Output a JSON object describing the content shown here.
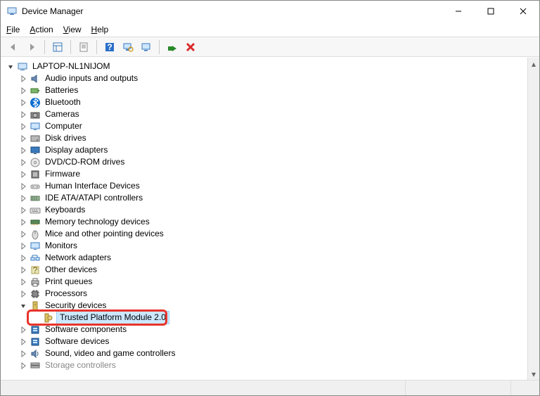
{
  "window": {
    "title": "Device Manager"
  },
  "menus": {
    "file": "File",
    "action": "Action",
    "view": "View",
    "help": "Help"
  },
  "root": {
    "label": "LAPTOP-NL1NIJOM",
    "expanded": true
  },
  "categories": [
    {
      "label": "Audio inputs and outputs",
      "icon": "speaker"
    },
    {
      "label": "Batteries",
      "icon": "battery"
    },
    {
      "label": "Bluetooth",
      "icon": "bluetooth"
    },
    {
      "label": "Cameras",
      "icon": "camera"
    },
    {
      "label": "Computer",
      "icon": "monitor"
    },
    {
      "label": "Disk drives",
      "icon": "disk"
    },
    {
      "label": "Display adapters",
      "icon": "display"
    },
    {
      "label": "DVD/CD-ROM drives",
      "icon": "cd"
    },
    {
      "label": "Firmware",
      "icon": "firmware"
    },
    {
      "label": "Human Interface Devices",
      "icon": "hid"
    },
    {
      "label": "IDE ATA/ATAPI controllers",
      "icon": "ide"
    },
    {
      "label": "Keyboards",
      "icon": "keyboard"
    },
    {
      "label": "Memory technology devices",
      "icon": "memory"
    },
    {
      "label": "Mice and other pointing devices",
      "icon": "mouse"
    },
    {
      "label": "Monitors",
      "icon": "monitor"
    },
    {
      "label": "Network adapters",
      "icon": "network"
    },
    {
      "label": "Other devices",
      "icon": "unknown"
    },
    {
      "label": "Print queues",
      "icon": "printer"
    },
    {
      "label": "Processors",
      "icon": "cpu"
    },
    {
      "label": "Security devices",
      "icon": "security",
      "expanded": true,
      "children": [
        {
          "label": "Trusted Platform Module 2.0",
          "icon": "tpm",
          "selected": true,
          "highlight": true
        }
      ]
    },
    {
      "label": "Software components",
      "icon": "software"
    },
    {
      "label": "Software devices",
      "icon": "software"
    },
    {
      "label": "Sound, video and game controllers",
      "icon": "sound"
    },
    {
      "label": "Storage controllers",
      "icon": "storage",
      "faded": true
    }
  ]
}
